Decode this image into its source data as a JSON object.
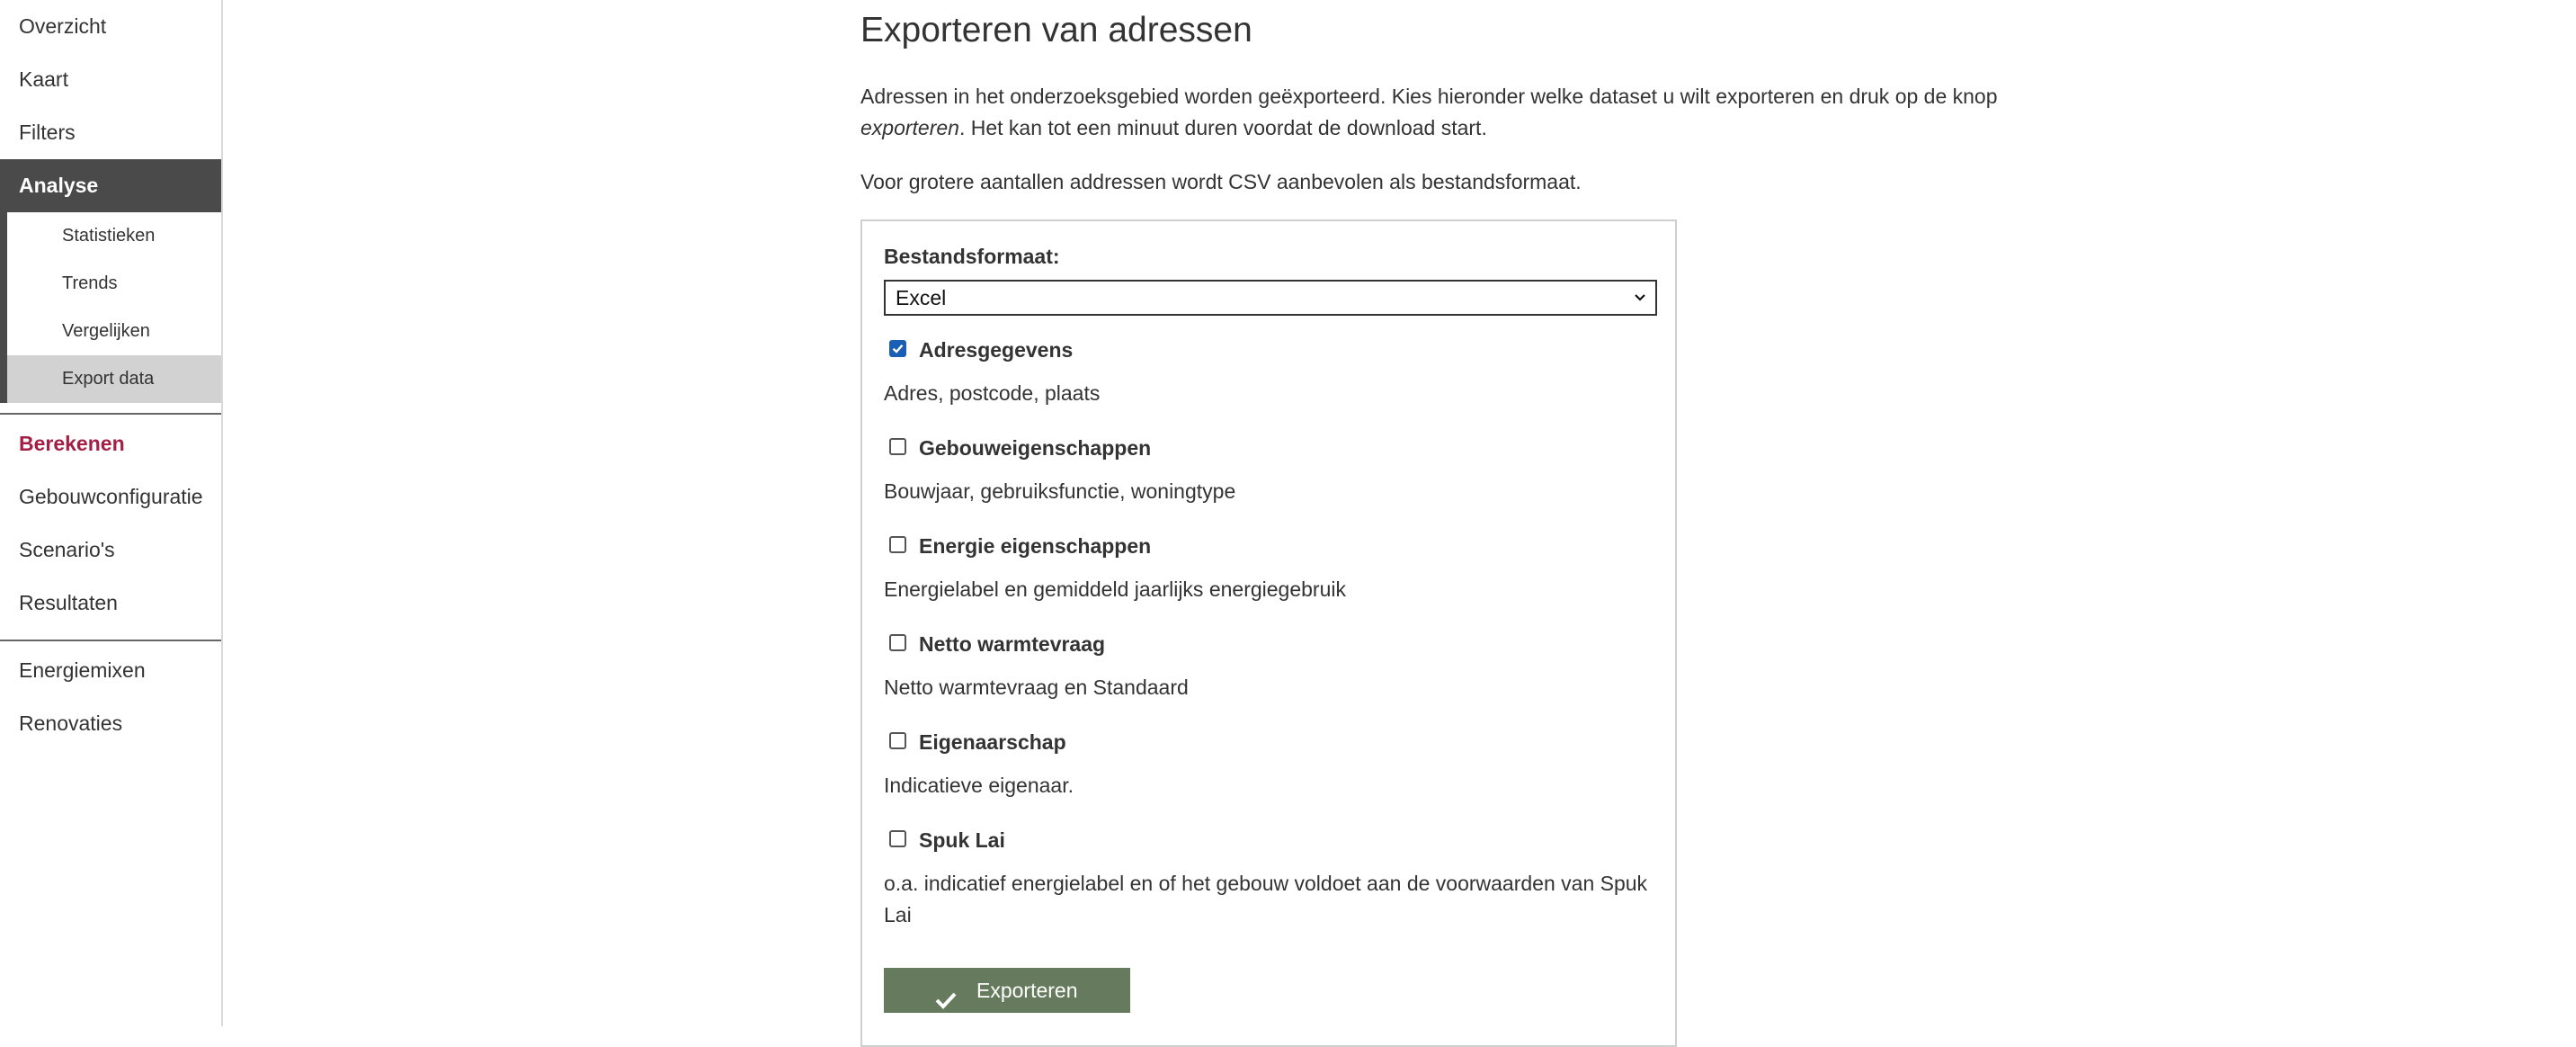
{
  "sidebar": {
    "items_top": [
      {
        "label": "Overzicht"
      },
      {
        "label": "Kaart"
      },
      {
        "label": "Filters"
      }
    ],
    "active": {
      "label": "Analyse"
    },
    "sub_items": [
      {
        "label": "Statistieken"
      },
      {
        "label": "Trends"
      },
      {
        "label": "Vergelijken"
      },
      {
        "label": "Export data",
        "selected": true
      }
    ],
    "section_calc": {
      "label": "Berekenen",
      "color": "#a31f45"
    },
    "items_calc": [
      {
        "label": "Gebouwconfiguratie"
      },
      {
        "label": "Scenario's"
      },
      {
        "label": "Resultaten"
      }
    ],
    "items_bottom": [
      {
        "label": "Energiemixen"
      },
      {
        "label": "Renovaties"
      }
    ]
  },
  "main": {
    "title": "Exporteren van adressen",
    "intro_part1": "Adressen in het onderzoeksgebied worden geëxporteerd. Kies hieronder welke dataset u wilt exporteren en druk op de knop ",
    "intro_em": "exporteren",
    "intro_part2": ". Het kan tot een minuut duren voordat de download start.",
    "intro2": "Voor grotere aantallen addressen wordt CSV aanbevolen als bestandsformaat.",
    "format_label": "Bestandsformaat:",
    "format_value": "Excel",
    "options": [
      {
        "title": "Adresgegevens",
        "desc": "Adres, postcode, plaats",
        "checked": true
      },
      {
        "title": "Gebouweigenschappen",
        "desc": "Bouwjaar, gebruiksfunctie, woningtype",
        "checked": false
      },
      {
        "title": "Energie eigenschappen",
        "desc": "Energielabel en gemiddeld jaarlijks energiegebruik",
        "checked": false
      },
      {
        "title": "Netto warmtevraag",
        "desc": "Netto warmtevraag en Standaard",
        "checked": false
      },
      {
        "title": "Eigenaarschap",
        "desc": "Indicatieve eigenaar.",
        "checked": false
      },
      {
        "title": "Spuk Lai",
        "desc": "o.a. indicatief energielabel en of het gebouw voldoet aan de voorwaarden van Spuk Lai",
        "checked": false
      }
    ],
    "export_label": "Exporteren"
  },
  "colors": {
    "active_bg": "#4a4a4a",
    "selected_sub_bg": "#d2d2d2",
    "accent": "#a31f45",
    "button_bg": "#667b5d",
    "checkbox_checked": "#1a5fb4"
  },
  "icons": {
    "select_arrow": "chevron-down-icon",
    "button_icon": "check-icon",
    "checkbox_mark": "checkmark-icon"
  }
}
